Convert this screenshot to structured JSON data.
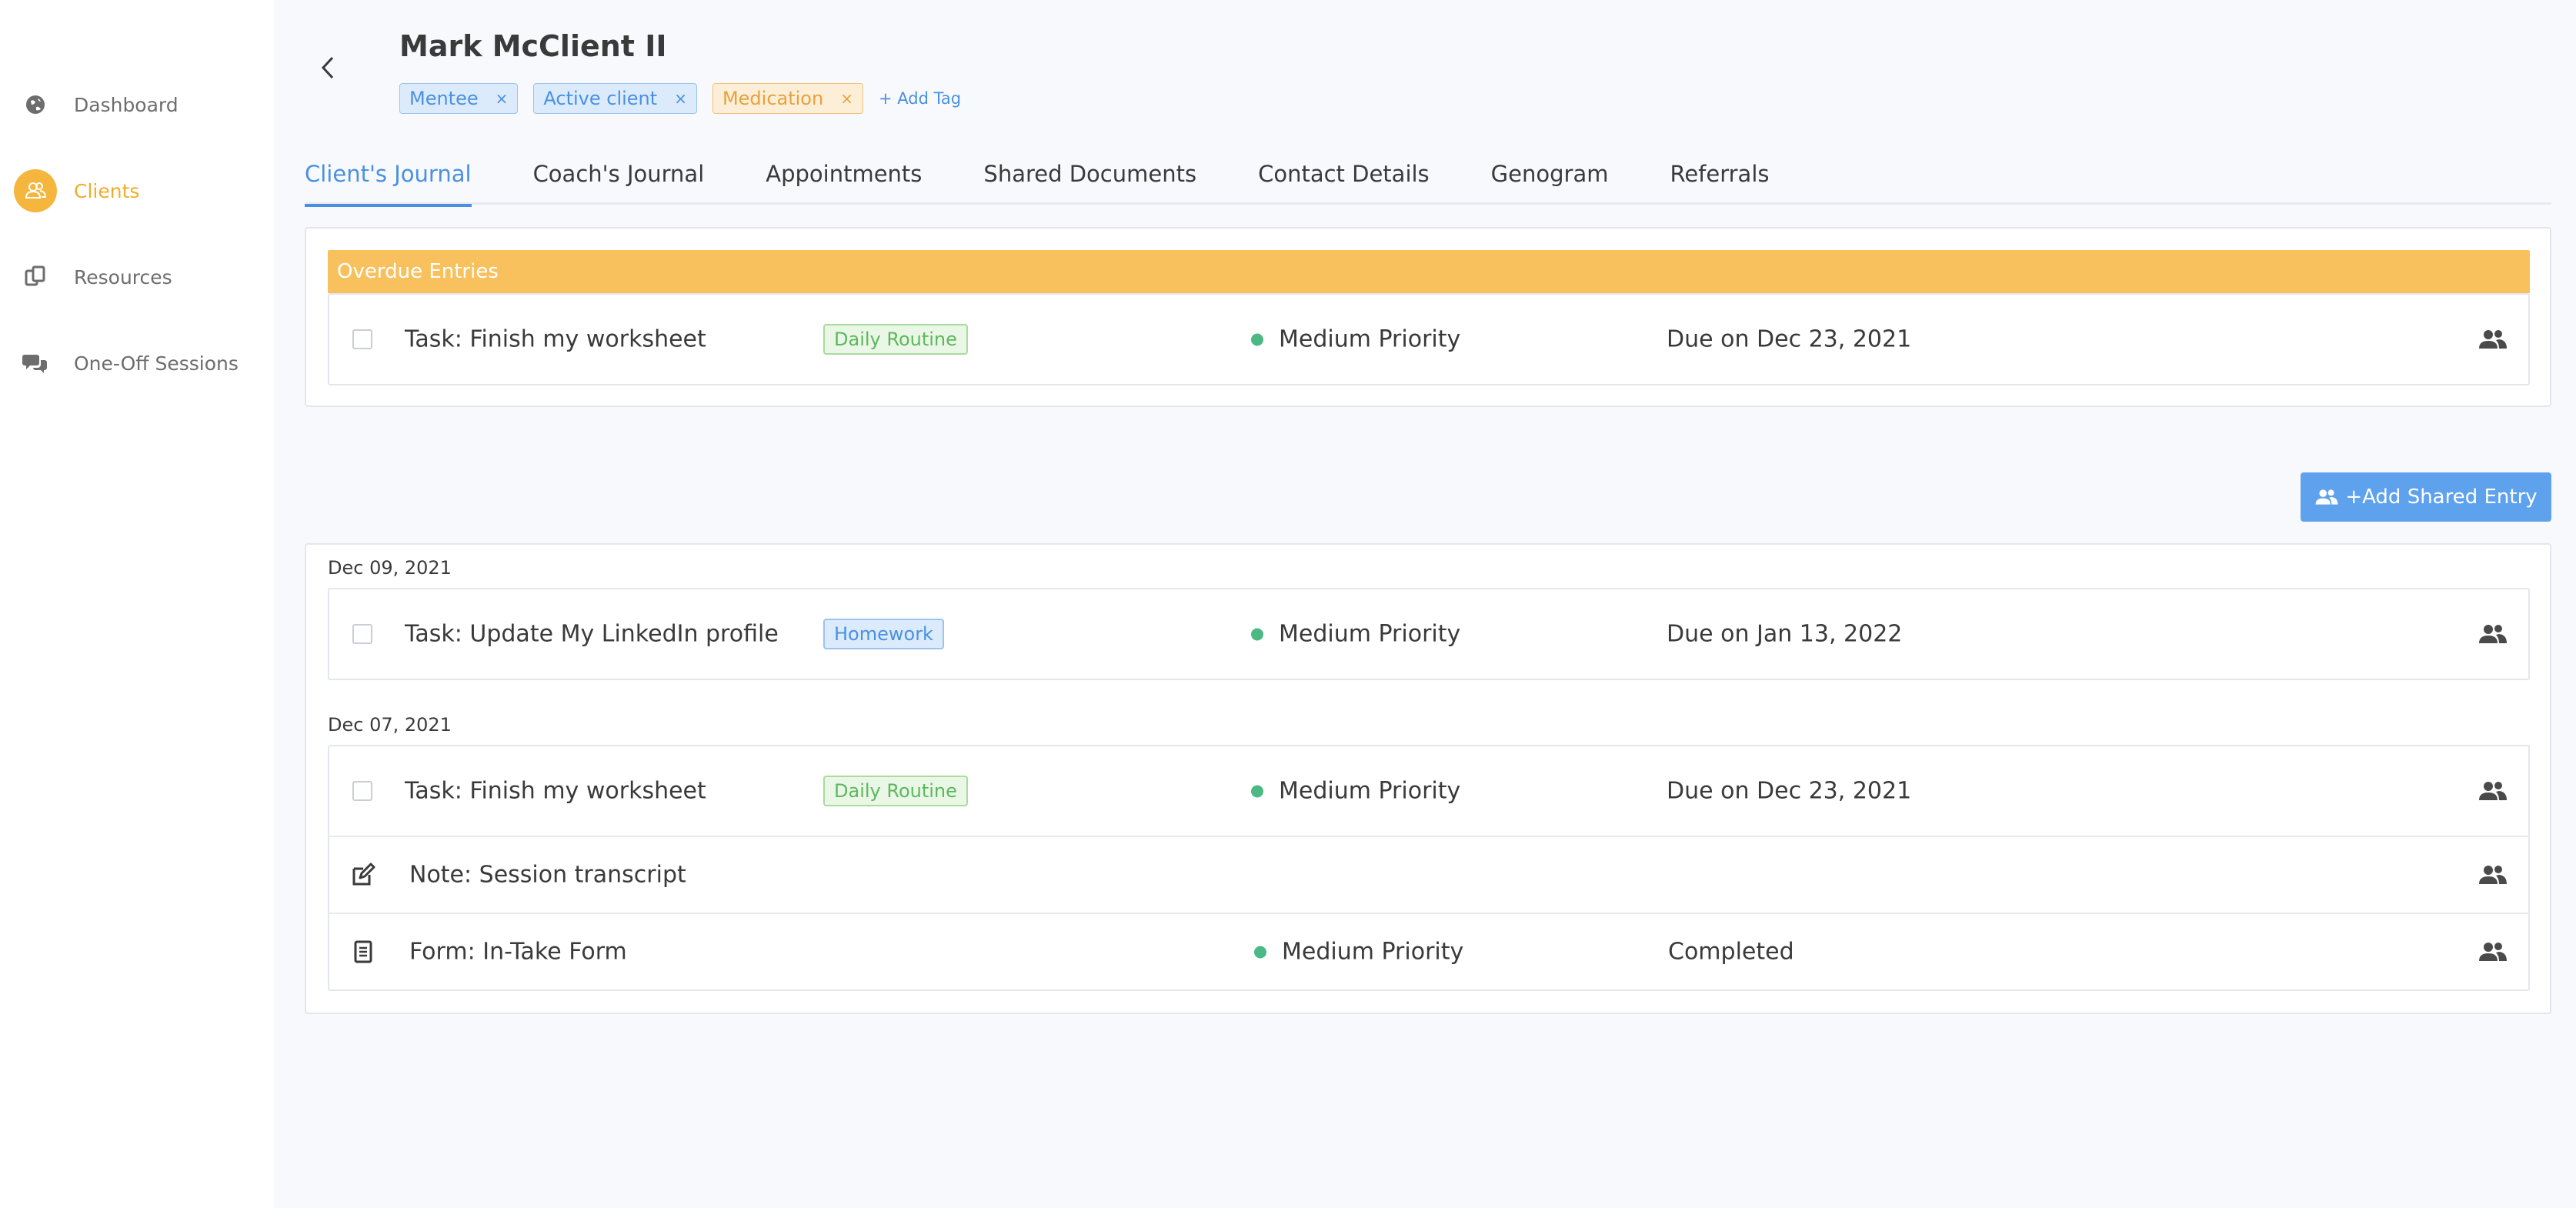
{
  "sidebar": {
    "items": [
      {
        "label": "Dashboard",
        "icon": "globe-icon"
      },
      {
        "label": "Clients",
        "icon": "clients-icon",
        "active": true
      },
      {
        "label": "Resources",
        "icon": "copy-icon"
      },
      {
        "label": "One-Off Sessions",
        "icon": "comments-icon"
      }
    ]
  },
  "header": {
    "client_name": "Mark McClient II",
    "tags": [
      {
        "label": "Mentee",
        "color": "#4a90e2"
      },
      {
        "label": "Active client",
        "color": "#4a90e2"
      },
      {
        "label": "Medication",
        "color": "#e8a13a"
      }
    ],
    "tag_remove": "×",
    "add_tag_label": "+ Add Tag"
  },
  "tabs": [
    {
      "label": "Client's Journal",
      "active": true
    },
    {
      "label": "Coach's Journal"
    },
    {
      "label": "Appointments"
    },
    {
      "label": "Shared Documents"
    },
    {
      "label": "Contact Details"
    },
    {
      "label": "Genogram"
    },
    {
      "label": "Referrals"
    }
  ],
  "overdue": {
    "header": "Overdue Entries",
    "entries": [
      {
        "title": "Task: Finish my worksheet",
        "category": "Daily Routine",
        "priority": "Medium Priority",
        "due": "Due on Dec 23, 2021"
      }
    ]
  },
  "add_shared_entry_label": "+Add Shared Entry",
  "journal": {
    "groups": [
      {
        "date": "Dec 09, 2021",
        "entries": [
          {
            "title": "Task: Update My LinkedIn profile",
            "category": "Homework",
            "priority": "Medium Priority",
            "due": "Due on Jan 13, 2022"
          }
        ]
      },
      {
        "date": "Dec 07, 2021",
        "entries": [
          {
            "title": "Task: Finish my worksheet",
            "category": "Daily Routine",
            "priority": "Medium Priority",
            "due": "Due on Dec 23, 2021"
          },
          {
            "title": "Note: Session transcript"
          },
          {
            "title": "Form: In-Take Form",
            "priority": "Medium Priority",
            "status": "Completed"
          }
        ]
      }
    ]
  },
  "colors": {
    "accent": "#4a90e2",
    "sidebar_active": "#f5b63e",
    "overdue_header": "#f8c15e",
    "priority_medium": "#4cb985",
    "button": "#5ea2ee"
  }
}
